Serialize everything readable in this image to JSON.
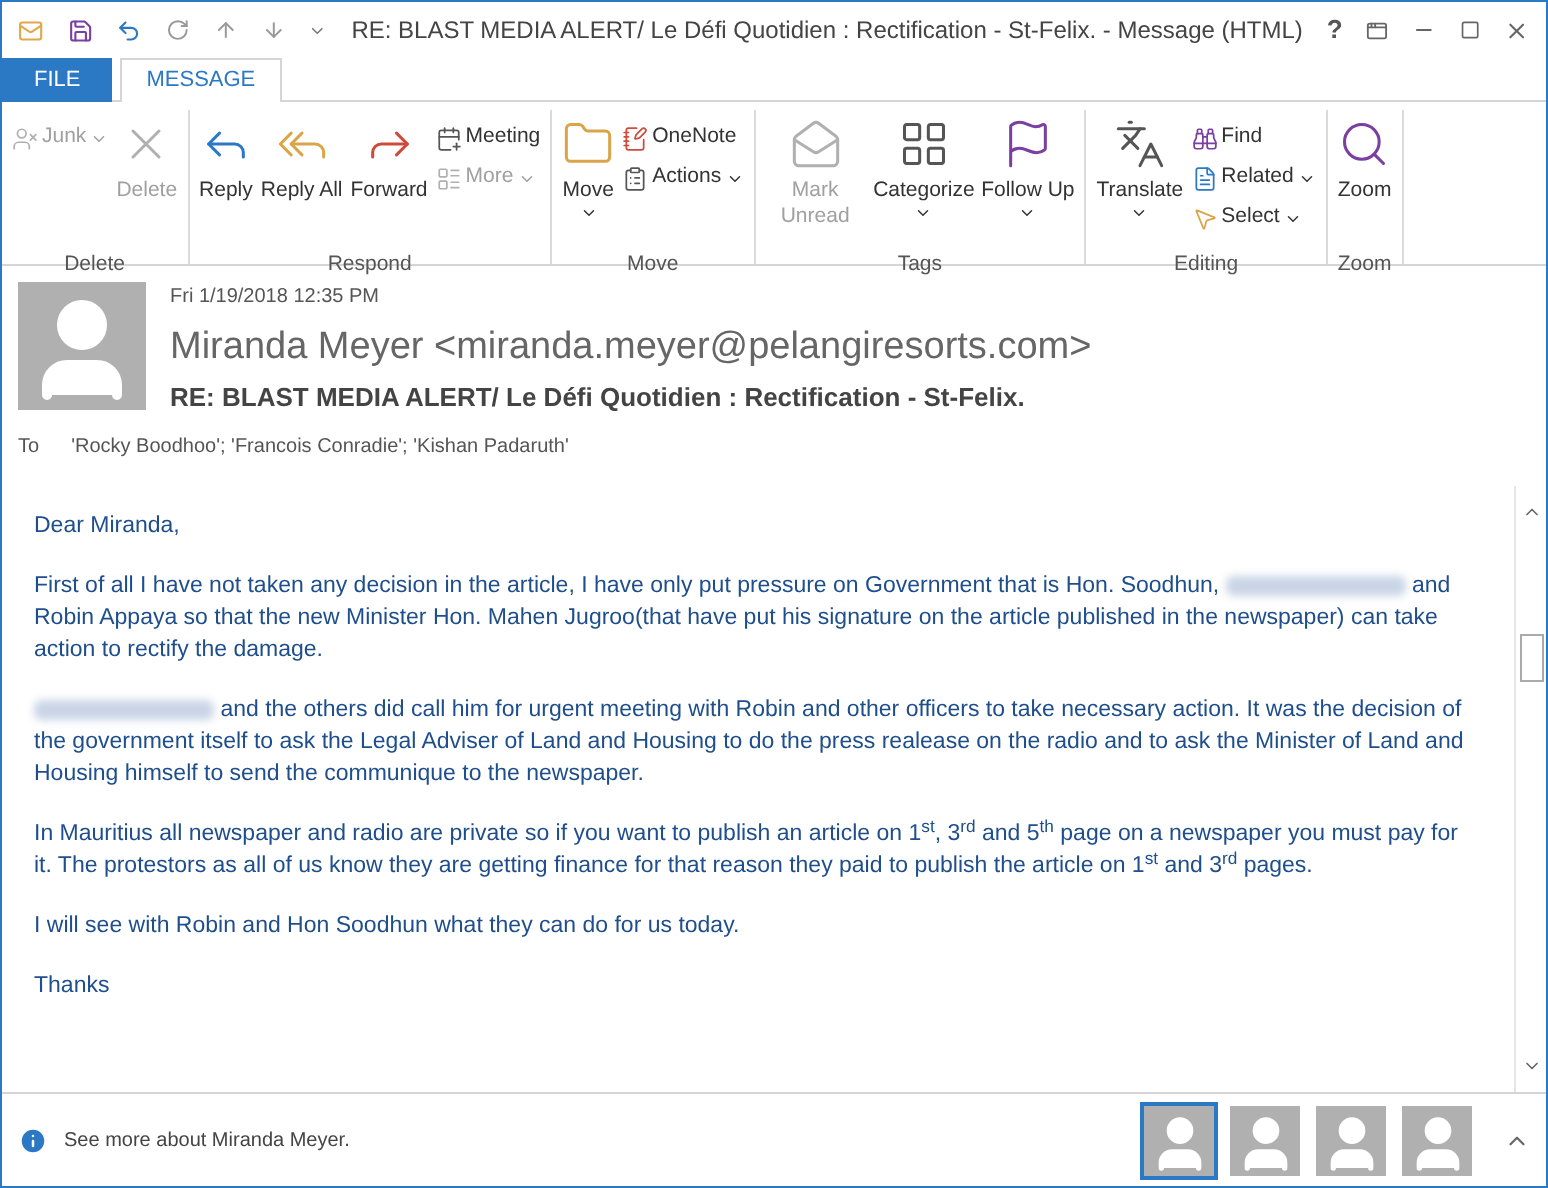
{
  "window": {
    "title": "RE: BLAST MEDIA ALERT/ Le Défi Quotidien : Rectification - St-Felix.  - Message (HTML)",
    "controls": [
      "?"
    ]
  },
  "tabs": [
    {
      "label": "FILE",
      "selected": false
    },
    {
      "label": "MESSAGE",
      "selected": true
    }
  ],
  "ribbon": [
    {
      "name": "Delete",
      "buttons": [
        {
          "kind": "small",
          "label": "Junk",
          "dropdown": true,
          "disabled": true
        },
        {
          "kind": "large",
          "label": "Delete",
          "dropdown": false,
          "disabled": true
        }
      ]
    },
    {
      "name": "Respond",
      "buttons": [
        {
          "kind": "large",
          "label": "Reply",
          "dropdown": false,
          "disabled": false
        },
        {
          "kind": "large",
          "label": "Reply All",
          "dropdown": false,
          "disabled": false
        },
        {
          "kind": "large",
          "label": "Forward",
          "dropdown": false,
          "disabled": false
        },
        {
          "kind": "small",
          "label": "Meeting",
          "dropdown": false,
          "disabled": false
        },
        {
          "kind": "small",
          "label": "More",
          "dropdown": true,
          "disabled": true
        }
      ]
    },
    {
      "name": "Move",
      "buttons": [
        {
          "kind": "large",
          "label": "Move",
          "dropdown": true,
          "disabled": false
        },
        {
          "kind": "small",
          "label": "OneNote",
          "dropdown": false,
          "disabled": false
        },
        {
          "kind": "small",
          "label": "Actions",
          "dropdown": true,
          "disabled": false
        }
      ]
    },
    {
      "name": "Tags",
      "buttons": [
        {
          "kind": "large",
          "label": "Mark Unread",
          "dropdown": false,
          "disabled": true
        },
        {
          "kind": "large",
          "label": "Categorize",
          "dropdown": true,
          "disabled": false
        },
        {
          "kind": "large",
          "label": "Follow Up",
          "dropdown": true,
          "disabled": false
        }
      ]
    },
    {
      "name": "Editing",
      "buttons": [
        {
          "kind": "large",
          "label": "Translate",
          "dropdown": true,
          "disabled": false
        },
        {
          "kind": "small",
          "label": "Find",
          "dropdown": false,
          "disabled": false
        },
        {
          "kind": "small",
          "label": "Related",
          "dropdown": true,
          "disabled": false
        },
        {
          "kind": "small",
          "label": "Select",
          "dropdown": true,
          "disabled": false
        }
      ]
    },
    {
      "name": "Zoom",
      "buttons": [
        {
          "kind": "large",
          "label": "Zoom",
          "dropdown": false,
          "disabled": false
        }
      ]
    }
  ],
  "header": {
    "date": "Fri 1/19/2018 12:35 PM",
    "from": "Miranda Meyer <miranda.meyer@pelangiresorts.com>",
    "subject": "RE: BLAST MEDIA ALERT/ Le Défi Quotidien : Rectification - St-Felix.",
    "to_label": "To",
    "to": "'Rocky Boodhoo'; 'Francois Conradie'; 'Kishan Padaruth'"
  },
  "body": [
    [
      {
        "kind": "text",
        "text": "Dear Miranda,"
      }
    ],
    [
      {
        "kind": "text",
        "text": "First of all I have not taken any decision in the article, I have only put pressure on Government that is Hon. Soodhun, "
      },
      {
        "kind": "redacted"
      },
      {
        "kind": "text",
        "text": " and Robin Appaya so that the new Minister Hon. Mahen Jugroo(that have put his signature on the article published in the newspaper) can take action to rectify the damage."
      }
    ],
    [
      {
        "kind": "redacted"
      },
      {
        "kind": "text",
        "text": " and the others did call him for urgent meeting with Robin and other officers to take necessary action. It was the decision of the government itself to ask the Legal Adviser of Land and Housing to do the press realease on the radio and to ask the Minister of Land and Housing himself to send the communique to the newspaper."
      }
    ],
    [
      {
        "kind": "text",
        "text": "In Mauritius all newspaper and radio are private so if you want to publish an article on 1$^{st}$, 3$^{rd}$ and 5$^{th}$ page on a newspaper you must pay for it. The protestors as all of us know they are getting finance for that reason they paid to publish the article on 1$^{st}$ and 3$^{rd}$ pages."
      }
    ],
    [
      {
        "kind": "text",
        "text": "I will see with Robin and Hon Soodhun what they can do for us today."
      }
    ],
    [
      {
        "kind": "text",
        "text": "Thanks"
      }
    ]
  ],
  "footer": {
    "text": "See more about Miranda Meyer.",
    "people": [
      {
        "selected": true
      },
      {
        "selected": false
      },
      {
        "selected": false
      },
      {
        "selected": false
      }
    ]
  }
}
